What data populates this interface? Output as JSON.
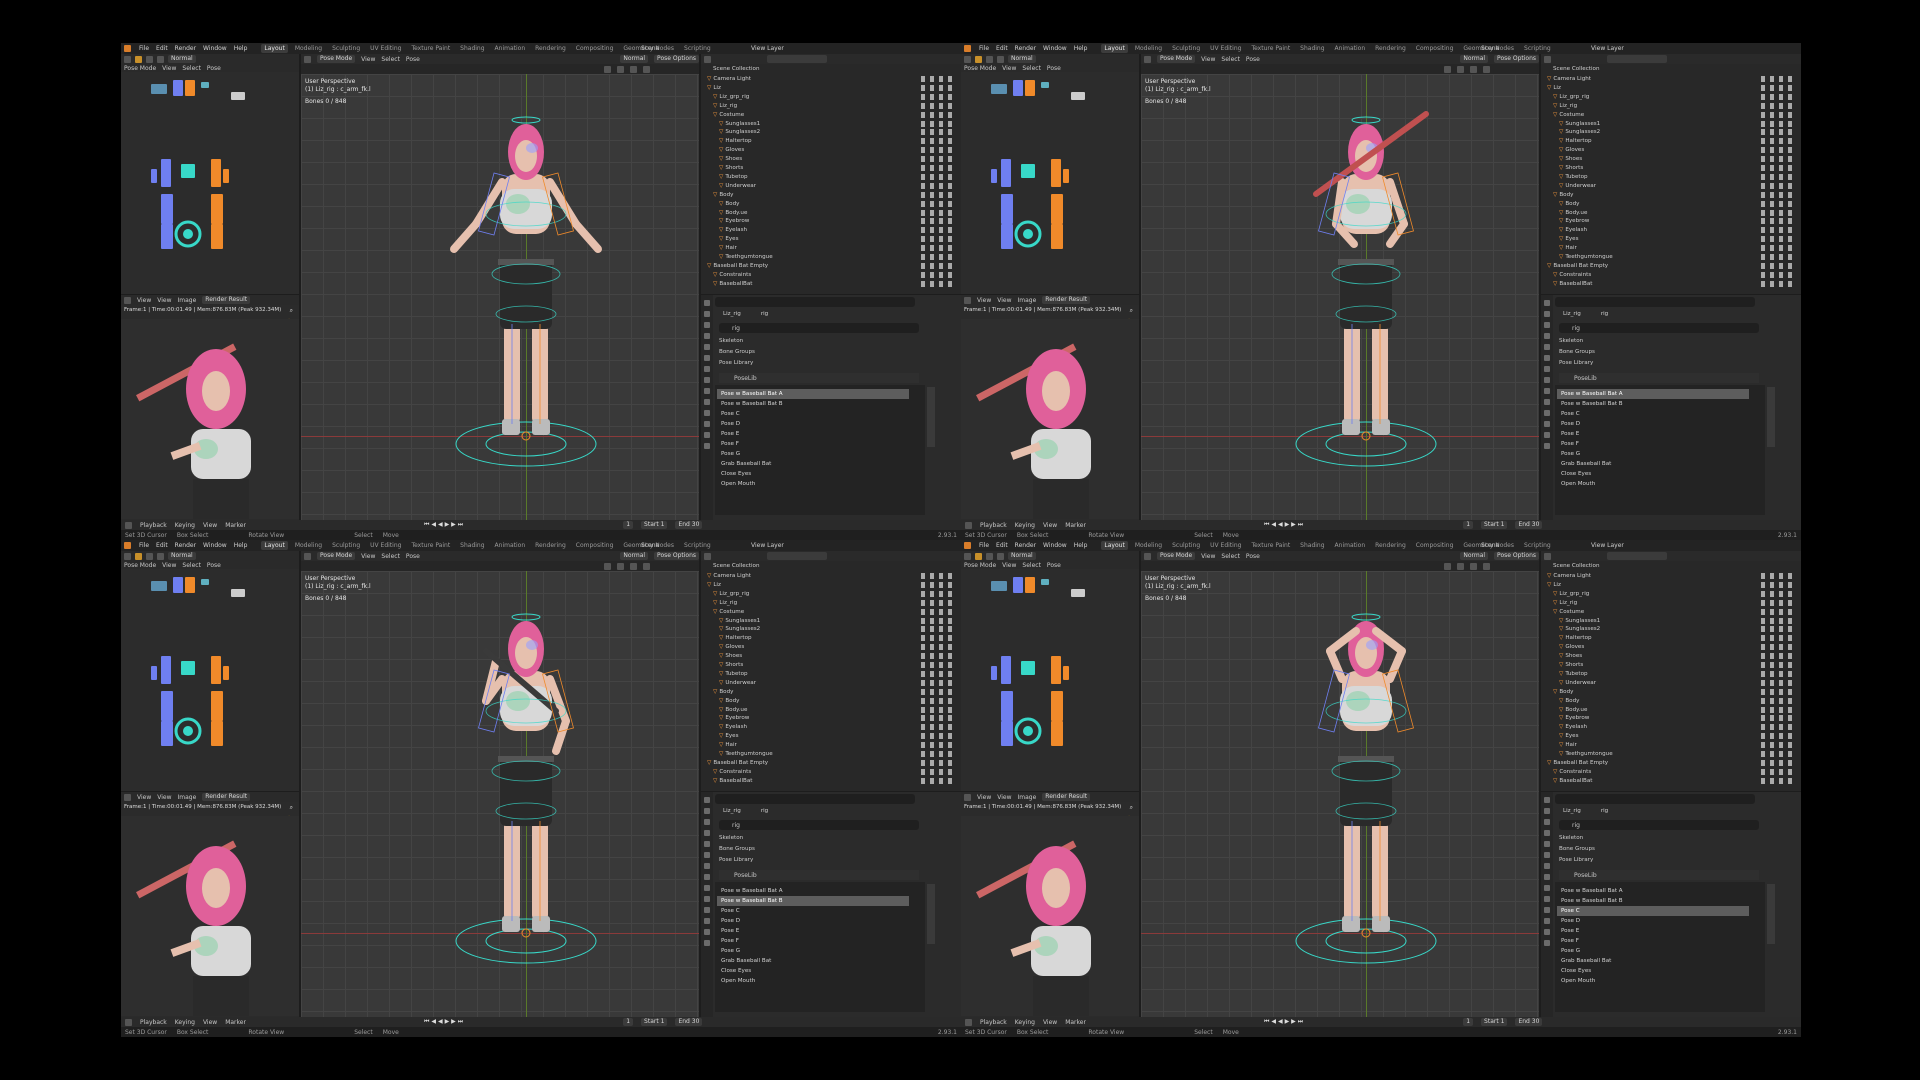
{
  "menu": [
    "File",
    "Edit",
    "Render",
    "Window",
    "Help"
  ],
  "workspaces": [
    "Layout",
    "Modeling",
    "Sculpting",
    "UV Editing",
    "Texture Paint",
    "Shading",
    "Animation",
    "Rendering",
    "Compositing",
    "Geometry Nodes",
    "Scripting"
  ],
  "active_workspace": "Layout",
  "scene": "Scene",
  "view_layer": "View Layer",
  "mode": "Pose Mode",
  "view_menu": [
    "View",
    "Select",
    "Pose"
  ],
  "pivot": "Normal",
  "pose_options": "Pose Options",
  "viewport": {
    "title": "User Perspective",
    "object": "(1) Liz_rig : c_arm_fk.l",
    "bones": "Bones      0 / 848"
  },
  "image_editor": {
    "menu": [
      "View",
      "View",
      "Image"
    ],
    "image": "Render Result",
    "info": "Frame:1 | Time:00:01.49 | Mem:876.83M (Peak 932.34M)"
  },
  "outliner": {
    "header": "Scene Collection",
    "items": [
      {
        "label": "Camera Light",
        "indent": 1
      },
      {
        "label": "Liz",
        "indent": 1
      },
      {
        "label": "Liz_grp_rig",
        "indent": 2
      },
      {
        "label": "Liz_rig",
        "indent": 2
      },
      {
        "label": "Costume",
        "indent": 2
      },
      {
        "label": "Sunglasses1",
        "indent": 3
      },
      {
        "label": "Sunglasses2",
        "indent": 3
      },
      {
        "label": "Haltertop",
        "indent": 3
      },
      {
        "label": "Gloves",
        "indent": 3
      },
      {
        "label": "Shoes",
        "indent": 3
      },
      {
        "label": "Shorts",
        "indent": 3
      },
      {
        "label": "Tubetop",
        "indent": 3
      },
      {
        "label": "Underwear",
        "indent": 3
      },
      {
        "label": "Body",
        "indent": 2
      },
      {
        "label": "Body",
        "indent": 3
      },
      {
        "label": "Body.ue",
        "indent": 3
      },
      {
        "label": "Eyebrow",
        "indent": 3
      },
      {
        "label": "Eyelash",
        "indent": 3
      },
      {
        "label": "Eyes",
        "indent": 3
      },
      {
        "label": "Hair",
        "indent": 3
      },
      {
        "label": "Teethgumtongue",
        "indent": 3
      },
      {
        "label": "Baseball Bat Empty",
        "indent": 1
      },
      {
        "label": "Constraints",
        "indent": 2
      },
      {
        "label": "BaseballBat",
        "indent": 2
      }
    ]
  },
  "properties": {
    "object": "Liz_rig",
    "data": "rig",
    "field": "rig",
    "sections": [
      "Skeleton",
      "Bone Groups",
      "Pose Library"
    ],
    "poselib": "PoseLib",
    "poses": [
      "Pose w Baseball Bat A",
      "Pose w Baseball Bat B",
      "Pose C",
      "Pose D",
      "Pose E",
      "Pose F",
      "Pose G",
      "Grab Baseball Bat",
      "Close Eyes",
      "Open Mouth"
    ]
  },
  "timeline": {
    "items": [
      "Playback",
      "Keying",
      "View",
      "Marker"
    ],
    "frame": "1",
    "start_label": "Start",
    "start": "1",
    "end_label": "End",
    "end": "30"
  },
  "status": {
    "items": [
      "Set 3D Cursor",
      "Box Select",
      "Rotate View",
      "Select",
      "Move"
    ],
    "version": "2.93.1"
  },
  "quadrants": [
    {
      "selected_pose": 0,
      "pose": "a"
    },
    {
      "selected_pose": 0,
      "pose": "bat"
    },
    {
      "selected_pose": 1,
      "pose": "bat2"
    },
    {
      "selected_pose": 2,
      "pose": "hands"
    }
  ],
  "colors": {
    "hair": "#e0609a",
    "skin": "#e6c0ae",
    "top": "#d8d8d8",
    "shorts": "#2a2a2a",
    "rig_cyan": "#38d8c8",
    "rig_orange": "#f08a2a",
    "rig_blue": "#6f7ff0",
    "selection": "#5d5d5d"
  }
}
